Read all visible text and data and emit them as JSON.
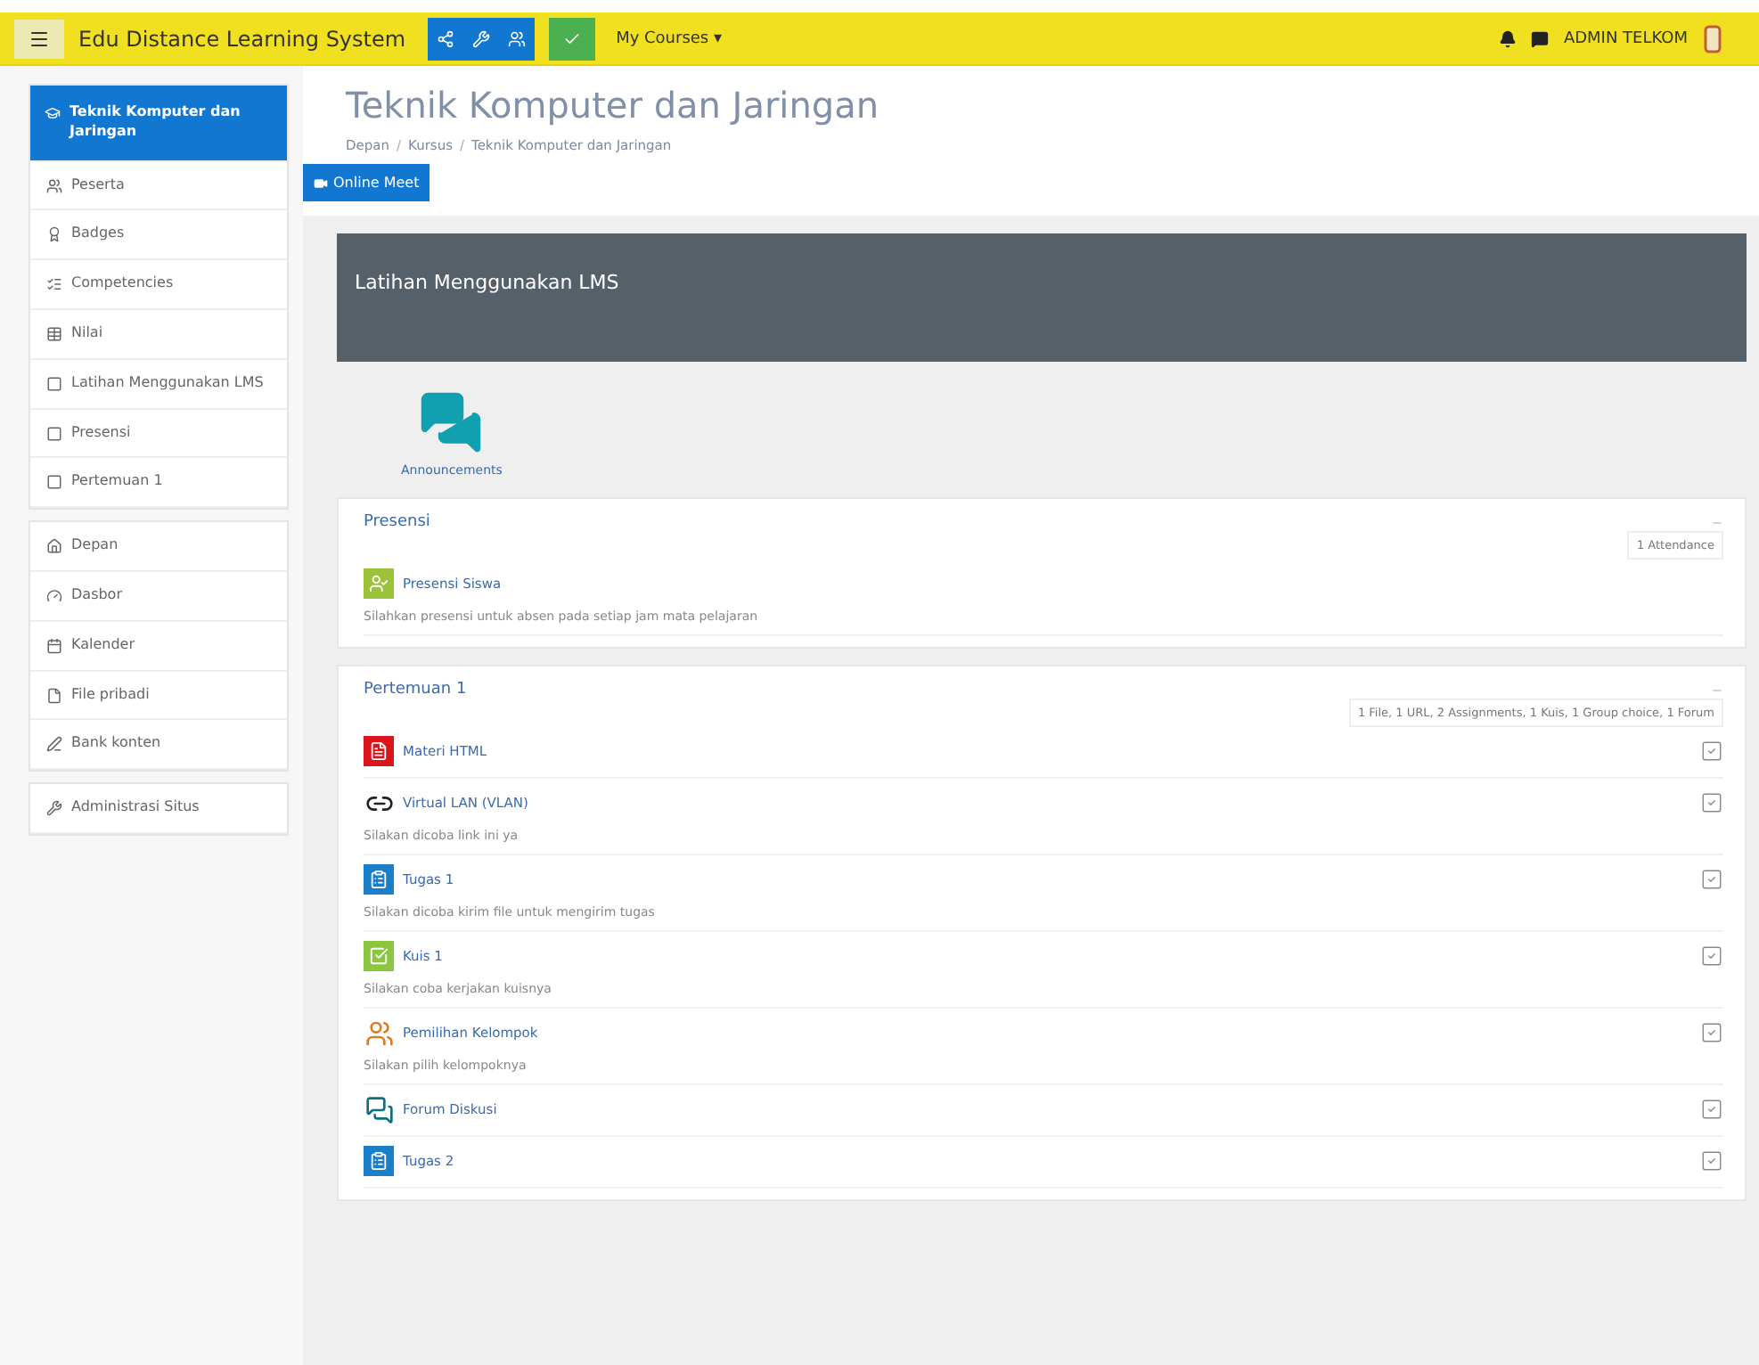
{
  "navbar": {
    "site_name": "Edu Distance Learning System",
    "menu": "My Courses ▾",
    "user": "ADMIN TELKOM"
  },
  "sidebar": {
    "groups": [
      {
        "items": [
          {
            "label": "Teknik Komputer dan Jaringan",
            "kind": "course",
            "selected": true
          },
          {
            "label": "Peserta",
            "kind": "users",
            "selected": false
          },
          {
            "label": "Badges",
            "kind": "badge",
            "selected": false
          },
          {
            "label": "Competencies",
            "kind": "competency",
            "selected": false
          },
          {
            "label": "Nilai",
            "kind": "grades",
            "selected": false
          },
          {
            "label": "Latihan Menggunakan LMS",
            "kind": "section",
            "selected": false
          },
          {
            "label": "Presensi",
            "kind": "section",
            "selected": false
          },
          {
            "label": "Pertemuan 1",
            "kind": "section",
            "selected": false
          }
        ]
      },
      {
        "items": [
          {
            "label": "Depan",
            "kind": "home",
            "selected": false
          },
          {
            "label": "Dasbor",
            "kind": "dashboard",
            "selected": false
          },
          {
            "label": "Kalender",
            "kind": "calendar",
            "selected": false
          },
          {
            "label": "File pribadi",
            "kind": "file",
            "selected": false
          },
          {
            "label": "Bank konten",
            "kind": "pen",
            "selected": false
          }
        ]
      },
      {
        "items": [
          {
            "label": "Administrasi Situs",
            "kind": "wrench",
            "selected": false
          }
        ]
      }
    ]
  },
  "page": {
    "title": "Teknik Komputer dan Jaringan",
    "breadcrumb": {
      "separator": "/",
      "items": [
        "Depan",
        "Kursus",
        "Teknik Komputer dan Jaringan"
      ]
    },
    "button": "Online Meet"
  },
  "banner": {
    "title": "Latihan Menggunakan LMS"
  },
  "announcements": "Announcements",
  "sections": [
    {
      "title": "Presensi",
      "summary": "1 Attendance",
      "activities": [
        {
          "name": "Presensi Siswa",
          "kind": "attendance",
          "description": "Silahkan presensi untuk absen pada setiap jam mata pelajaran"
        }
      ]
    },
    {
      "title": "Pertemuan 1",
      "summary": "1 File, 1 URL, 2 Assignments, 1 Kuis, 1 Group choice, 1 Forum",
      "activities": [
        {
          "name": "Materi HTML",
          "kind": "pdf",
          "checked": true
        },
        {
          "name": "Virtual LAN (VLAN)",
          "kind": "url",
          "description": "Silakan dicoba link ini ya",
          "checked": true
        },
        {
          "name": "Tugas 1",
          "kind": "assign",
          "description": "Silakan dicoba kirim file untuk mengirim tugas",
          "checked": true
        },
        {
          "name": "Kuis 1",
          "kind": "quiz",
          "description": "Silakan coba kerjakan kuisnya",
          "checked": true
        },
        {
          "name": "Pemilihan Kelompok",
          "kind": "choice",
          "description": "Silakan pilih kelompoknya",
          "checked": true
        },
        {
          "name": "Forum Diskusi",
          "kind": "forum",
          "checked": true
        },
        {
          "name": "Tugas 2",
          "kind": "assign",
          "checked": true
        }
      ]
    }
  ]
}
